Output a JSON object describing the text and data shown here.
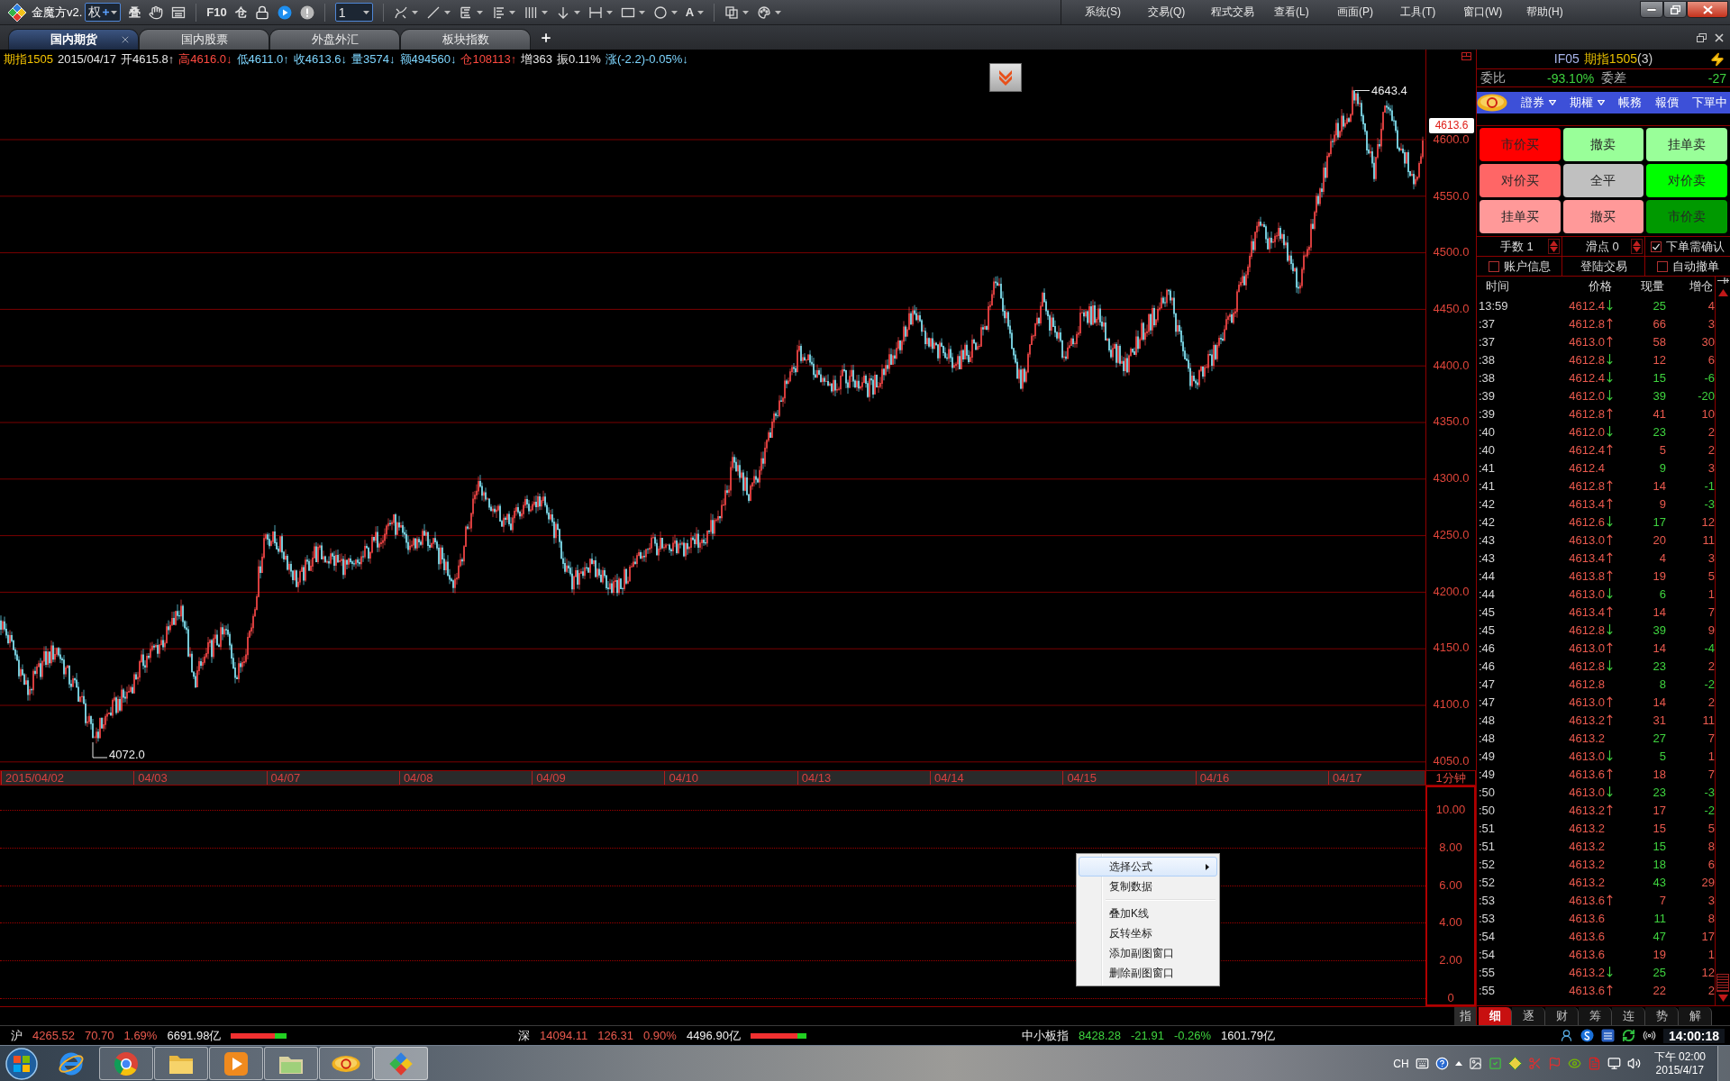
{
  "app_title": "金魔方v2.",
  "toolbar": {
    "adjust": "权",
    "overlay": "叠",
    "f10": "F10",
    "position": "仓",
    "period": "1",
    "text_tool": "A"
  },
  "menu": [
    "系统(S)",
    "交易(Q)",
    "程式交易",
    "查看(L)",
    "画面(P)",
    "工具(T)",
    "窗口(W)",
    "帮助(H)"
  ],
  "tabs": [
    {
      "label": "国内期货",
      "selected": true
    },
    {
      "label": "国内股票",
      "selected": false
    },
    {
      "label": "外盘外汇",
      "selected": false
    },
    {
      "label": "板块指数",
      "selected": false
    }
  ],
  "quote_line": [
    {
      "text": "期指1505",
      "color": "#f5c400"
    },
    {
      "text": "2015/04/17",
      "color": "#e8e8e8"
    },
    {
      "text": "开4615.8↑",
      "color": "#e8e8e8"
    },
    {
      "text": "高4616.0↓",
      "color": "#ff4a40"
    },
    {
      "text": "低4611.0↑",
      "color": "#7ed6ff"
    },
    {
      "text": "收4613.6↓",
      "color": "#7ed6ff"
    },
    {
      "text": "量3574↓",
      "color": "#7ed6ff"
    },
    {
      "text": "额494560↓",
      "color": "#7ed6ff"
    },
    {
      "text": "仓108113↑",
      "color": "#ff4a40"
    },
    {
      "text": "增363",
      "color": "#e8e8e8"
    },
    {
      "text": "振0.11%",
      "color": "#e8e8e8"
    },
    {
      "text": "涨(-2.2)-0.05%↓",
      "color": "#7ed6ff"
    }
  ],
  "main_chart": {
    "price_labels": [
      "4600.0",
      "4550.0",
      "4500.0",
      "4450.0",
      "4400.0",
      "4350.0",
      "4300.0",
      "4250.0",
      "4200.0",
      "4150.0",
      "4100.0",
      "4050.0"
    ],
    "date_labels": [
      "2015/04/02",
      "04/03",
      "04/07",
      "04/08",
      "04/09",
      "04/10",
      "04/13",
      "04/14",
      "04/15",
      "04/16",
      "04/17"
    ],
    "period": "1分钟",
    "high_label": "4643.4",
    "low_label": "4072.0",
    "last_price": "4613.6"
  },
  "sub_chart": {
    "value_labels": [
      "10.00",
      "8.00",
      "6.00",
      "4.00",
      "2.00",
      "0"
    ],
    "tab": "指"
  },
  "context_menu": [
    {
      "kind": "item",
      "label": "选择公式",
      "highlighted": true,
      "submenu": true
    },
    {
      "kind": "item",
      "label": "复制数据",
      "highlighted": false,
      "submenu": false
    },
    {
      "kind": "separator"
    },
    {
      "kind": "item",
      "label": "叠加K线",
      "highlighted": false,
      "submenu": false
    },
    {
      "kind": "item",
      "label": "反转坐标",
      "highlighted": false,
      "submenu": false
    },
    {
      "kind": "item",
      "label": "添加副图窗口",
      "highlighted": false,
      "submenu": false
    },
    {
      "kind": "item",
      "label": "删除副图窗口",
      "highlighted": false,
      "submenu": false
    }
  ],
  "quote_panel": {
    "code": "IF05",
    "name": "期指1505",
    "count": "(3)",
    "ratio_label": "委比",
    "ratio": "-93.10%",
    "diff_label": "委差",
    "diff": "-27"
  },
  "broker_bar": [
    {
      "label": "證券",
      "dropdown": true
    },
    {
      "label": "期權",
      "dropdown": true
    },
    {
      "label": "帳務",
      "dropdown": false
    },
    {
      "label": "報價",
      "dropdown": false
    },
    {
      "label": "下單中",
      "dropdown": false
    }
  ],
  "trade_buttons": [
    {
      "label": "市价买",
      "color": "#ff0000"
    },
    {
      "label": "撤卖",
      "color": "#99ff99"
    },
    {
      "label": "挂单卖",
      "color": "#99ff99"
    },
    {
      "label": "对价买",
      "color": "#ff6666"
    },
    {
      "label": "全平",
      "color": "#c0c0c0"
    },
    {
      "label": "对价卖",
      "color": "#00ff00"
    },
    {
      "label": "挂单买",
      "color": "#ff9999"
    },
    {
      "label": "撤买",
      "color": "#ff9999"
    },
    {
      "label": "市价卖",
      "color": "#009900"
    }
  ],
  "order_settings": {
    "lots": "手数 1",
    "slippage": "滑点 0",
    "confirm": {
      "label": "下单需确认",
      "checked": true
    },
    "account": {
      "label": "账户信息",
      "checked": false
    },
    "login": "登陆交易",
    "auto_cancel": {
      "label": "自动撤单",
      "checked": false
    }
  },
  "ticks": {
    "columns": [
      "时间",
      "价格",
      "现量",
      "增仓"
    ],
    "rows": [
      {
        "time": "13:59",
        "price": "4612.4",
        "up": false,
        "down": true,
        "volume": "25",
        "buy": false,
        "oi": "4",
        "oi_rising": true
      },
      {
        "time": ":37",
        "price": "4612.8",
        "up": true,
        "down": false,
        "volume": "66",
        "buy": true,
        "oi": "3",
        "oi_rising": true
      },
      {
        "time": ":37",
        "price": "4613.0",
        "up": true,
        "down": false,
        "volume": "58",
        "buy": true,
        "oi": "30",
        "oi_rising": true
      },
      {
        "time": ":38",
        "price": "4612.8",
        "up": false,
        "down": true,
        "volume": "12",
        "buy": true,
        "oi": "6",
        "oi_rising": true
      },
      {
        "time": ":38",
        "price": "4612.4",
        "up": false,
        "down": true,
        "volume": "15",
        "buy": false,
        "oi": "-6",
        "oi_rising": false
      },
      {
        "time": ":39",
        "price": "4612.0",
        "up": false,
        "down": true,
        "volume": "39",
        "buy": false,
        "oi": "-20",
        "oi_rising": false
      },
      {
        "time": ":39",
        "price": "4612.8",
        "up": true,
        "down": false,
        "volume": "41",
        "buy": true,
        "oi": "10",
        "oi_rising": true
      },
      {
        "time": ":40",
        "price": "4612.0",
        "up": false,
        "down": true,
        "volume": "23",
        "buy": false,
        "oi": "2",
        "oi_rising": true
      },
      {
        "time": ":40",
        "price": "4612.4",
        "up": true,
        "down": false,
        "volume": "5",
        "buy": true,
        "oi": "2",
        "oi_rising": true
      },
      {
        "time": ":41",
        "price": "4612.4",
        "up": false,
        "down": false,
        "volume": "9",
        "buy": false,
        "oi": "3",
        "oi_rising": true
      },
      {
        "time": ":41",
        "price": "4612.8",
        "up": true,
        "down": false,
        "volume": "14",
        "buy": true,
        "oi": "-1",
        "oi_rising": false
      },
      {
        "time": ":42",
        "price": "4613.4",
        "up": true,
        "down": false,
        "volume": "9",
        "buy": true,
        "oi": "-3",
        "oi_rising": false
      },
      {
        "time": ":42",
        "price": "4612.6",
        "up": false,
        "down": true,
        "volume": "17",
        "buy": false,
        "oi": "12",
        "oi_rising": true
      },
      {
        "time": ":43",
        "price": "4613.0",
        "up": true,
        "down": false,
        "volume": "20",
        "buy": true,
        "oi": "11",
        "oi_rising": true
      },
      {
        "time": ":43",
        "price": "4613.4",
        "up": true,
        "down": false,
        "volume": "4",
        "buy": true,
        "oi": "3",
        "oi_rising": true
      },
      {
        "time": ":44",
        "price": "4613.8",
        "up": true,
        "down": false,
        "volume": "19",
        "buy": true,
        "oi": "5",
        "oi_rising": true
      },
      {
        "time": ":44",
        "price": "4613.0",
        "up": false,
        "down": true,
        "volume": "6",
        "buy": false,
        "oi": "1",
        "oi_rising": true
      },
      {
        "time": ":45",
        "price": "4613.4",
        "up": true,
        "down": false,
        "volume": "14",
        "buy": true,
        "oi": "7",
        "oi_rising": true
      },
      {
        "time": ":45",
        "price": "4612.8",
        "up": false,
        "down": true,
        "volume": "39",
        "buy": false,
        "oi": "9",
        "oi_rising": true
      },
      {
        "time": ":46",
        "price": "4613.0",
        "up": true,
        "down": false,
        "volume": "14",
        "buy": true,
        "oi": "-4",
        "oi_rising": false
      },
      {
        "time": ":46",
        "price": "4612.8",
        "up": false,
        "down": true,
        "volume": "23",
        "buy": false,
        "oi": "2",
        "oi_rising": true
      },
      {
        "time": ":47",
        "price": "4612.8",
        "up": false,
        "down": false,
        "volume": "8",
        "buy": false,
        "oi": "-2",
        "oi_rising": false
      },
      {
        "time": ":47",
        "price": "4613.0",
        "up": true,
        "down": false,
        "volume": "14",
        "buy": true,
        "oi": "2",
        "oi_rising": true
      },
      {
        "time": ":48",
        "price": "4613.2",
        "up": true,
        "down": false,
        "volume": "31",
        "buy": true,
        "oi": "11",
        "oi_rising": true
      },
      {
        "time": ":48",
        "price": "4613.2",
        "up": false,
        "down": false,
        "volume": "27",
        "buy": false,
        "oi": "7",
        "oi_rising": true
      },
      {
        "time": ":49",
        "price": "4613.0",
        "up": false,
        "down": true,
        "volume": "5",
        "buy": false,
        "oi": "1",
        "oi_rising": true
      },
      {
        "time": ":49",
        "price": "4613.6",
        "up": true,
        "down": false,
        "volume": "18",
        "buy": true,
        "oi": "7",
        "oi_rising": true
      },
      {
        "time": ":50",
        "price": "4613.0",
        "up": false,
        "down": true,
        "volume": "23",
        "buy": false,
        "oi": "-3",
        "oi_rising": false
      },
      {
        "time": ":50",
        "price": "4613.2",
        "up": true,
        "down": false,
        "volume": "17",
        "buy": true,
        "oi": "-2",
        "oi_rising": false
      },
      {
        "time": ":51",
        "price": "4613.2",
        "up": false,
        "down": false,
        "volume": "15",
        "buy": true,
        "oi": "5",
        "oi_rising": true
      },
      {
        "time": ":51",
        "price": "4613.2",
        "up": false,
        "down": false,
        "volume": "15",
        "buy": false,
        "oi": "8",
        "oi_rising": true
      },
      {
        "time": ":52",
        "price": "4613.2",
        "up": false,
        "down": false,
        "volume": "18",
        "buy": false,
        "oi": "6",
        "oi_rising": true
      },
      {
        "time": ":52",
        "price": "4613.2",
        "up": false,
        "down": false,
        "volume": "43",
        "buy": false,
        "oi": "29",
        "oi_rising": true
      },
      {
        "time": ":53",
        "price": "4613.6",
        "up": true,
        "down": false,
        "volume": "7",
        "buy": true,
        "oi": "3",
        "oi_rising": true
      },
      {
        "time": ":53",
        "price": "4613.6",
        "up": false,
        "down": false,
        "volume": "11",
        "buy": false,
        "oi": "8",
        "oi_rising": true
      },
      {
        "time": ":54",
        "price": "4613.6",
        "up": false,
        "down": false,
        "volume": "47",
        "buy": false,
        "oi": "17",
        "oi_rising": true
      },
      {
        "time": ":54",
        "price": "4613.6",
        "up": false,
        "down": false,
        "volume": "19",
        "buy": true,
        "oi": "1",
        "oi_rising": true
      },
      {
        "time": ":55",
        "price": "4613.2",
        "up": false,
        "down": true,
        "volume": "25",
        "buy": false,
        "oi": "12",
        "oi_rising": true
      },
      {
        "time": ":55",
        "price": "4613.6",
        "up": true,
        "down": false,
        "volume": "22",
        "buy": true,
        "oi": "2",
        "oi_rising": true
      }
    ]
  },
  "detail_tabs": [
    {
      "label": "细",
      "selected": true
    },
    {
      "label": "逐",
      "selected": false
    },
    {
      "label": "财",
      "selected": false
    },
    {
      "label": "筹",
      "selected": false
    },
    {
      "label": "连",
      "selected": false
    },
    {
      "label": "势",
      "selected": false
    },
    {
      "label": "解",
      "selected": false
    }
  ],
  "status_bar": {
    "indices": [
      {
        "name": "沪",
        "price": "4265.52",
        "change": "70.70",
        "percent": "1.69%",
        "amount": "6691.98亿",
        "rising": true,
        "level": 0.79
      },
      {
        "name": "深",
        "price": "14094.11",
        "change": "126.31",
        "percent": "0.90%",
        "amount": "4496.90亿",
        "rising": true,
        "level": 0.84
      },
      {
        "name": "中小板指",
        "price": "8428.28",
        "change": "-21.91",
        "percent": "-0.26%",
        "amount": "1601.79亿",
        "rising": false
      }
    ],
    "time": "14:00:18"
  },
  "taskbar": {
    "apps": [
      {
        "running": false,
        "active": false
      },
      {
        "running": true,
        "active": false
      },
      {
        "running": true,
        "active": false
      },
      {
        "running": true,
        "active": false
      },
      {
        "running": true,
        "active": false
      },
      {
        "running": true,
        "active": false
      },
      {
        "running": true,
        "active": true
      }
    ],
    "language": "CH",
    "clock_time": "下午 02:00",
    "clock_date": "2015/4/17"
  }
}
